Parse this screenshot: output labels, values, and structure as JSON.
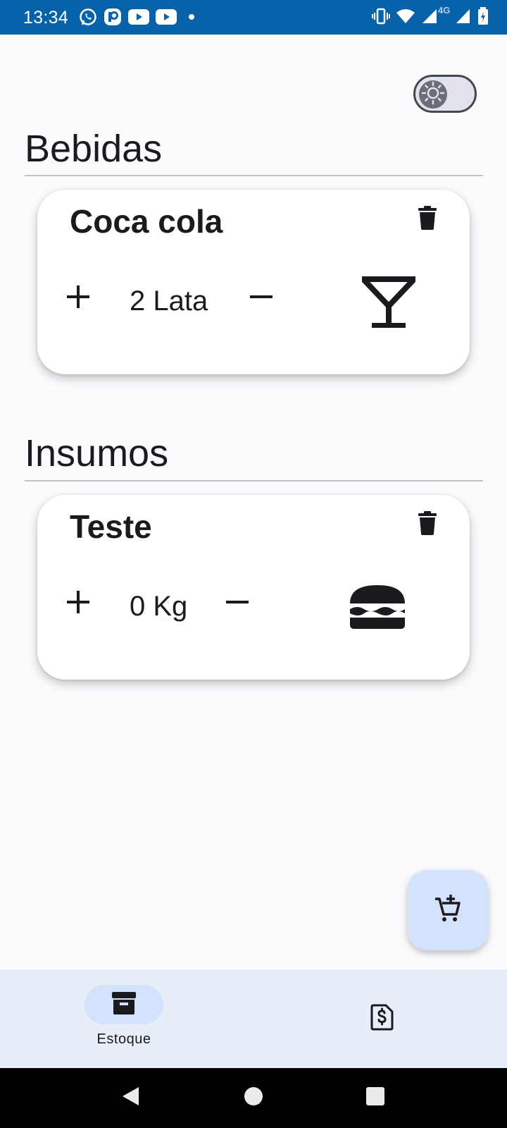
{
  "status_bar": {
    "time": "13:34",
    "network_label": "4G",
    "left_icons": [
      "whatsapp-icon",
      "app-icon",
      "youtube-icon",
      "youtube-icon",
      "dot-icon"
    ],
    "right_icons": [
      "vibrate-icon",
      "wifi-icon",
      "signal-icon",
      "signal-icon",
      "battery-icon"
    ],
    "background": "#0762a9"
  },
  "theme_toggle": {
    "icon": "sun-icon",
    "state": "off"
  },
  "sections": [
    {
      "title": "Bebidas",
      "items": [
        {
          "name": "Coca cola",
          "quantity": "2 Lata",
          "category_icon": "cocktail-glass-icon"
        }
      ]
    },
    {
      "title": "Insumos",
      "items": [
        {
          "name": "Teste",
          "quantity": "0 Kg",
          "category_icon": "burger-icon"
        }
      ]
    }
  ],
  "fab": {
    "icon": "add-cart-icon"
  },
  "bottom_nav": {
    "items": [
      {
        "label": "Estoque",
        "icon": "archive-box-icon",
        "selected": true
      },
      {
        "label": "",
        "icon": "invoice-dollar-icon",
        "selected": false
      }
    ]
  },
  "colors": {
    "accent_container": "#d3e3fd",
    "nav_background": "#e8eef8",
    "surface": "#fbfbfe"
  }
}
